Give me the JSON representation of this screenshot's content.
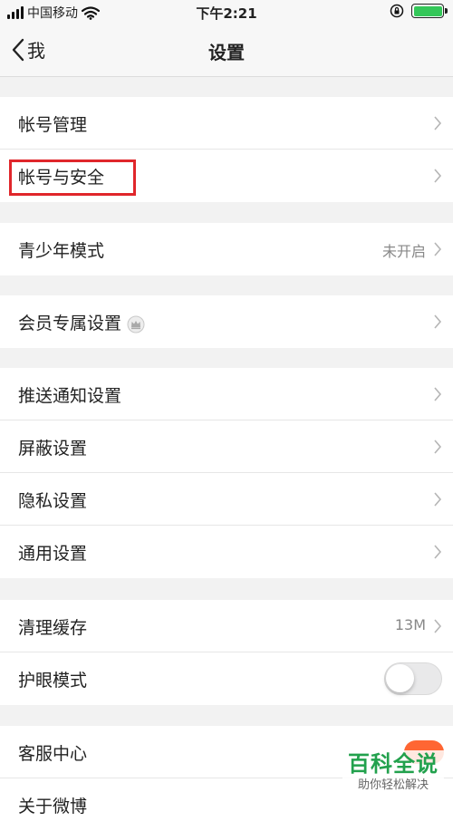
{
  "status_bar": {
    "carrier": "中国移动",
    "time": "下午2:21",
    "icons": [
      "signal-bars-icon",
      "wifi-icon",
      "orientation-lock-icon",
      "battery-icon"
    ],
    "battery_color": "#34c759"
  },
  "nav": {
    "back_label": "我",
    "title": "设置"
  },
  "groups": [
    {
      "items": [
        {
          "label": "帐号管理"
        },
        {
          "label": "帐号与安全"
        }
      ]
    },
    {
      "items": [
        {
          "label": "青少年模式",
          "value": "未开启"
        }
      ]
    },
    {
      "items": [
        {
          "label": "会员专属设置",
          "icon": "vip-crown-icon"
        }
      ]
    },
    {
      "items": [
        {
          "label": "推送通知设置"
        },
        {
          "label": "屏蔽设置"
        },
        {
          "label": "隐私设置"
        },
        {
          "label": "通用设置"
        }
      ]
    },
    {
      "items": [
        {
          "label": "清理缓存",
          "value": "13M"
        },
        {
          "label": "护眼模式",
          "toggle": false
        }
      ]
    },
    {
      "items": [
        {
          "label": "客服中心"
        },
        {
          "label": "关于微博"
        }
      ]
    }
  ],
  "annotation": {
    "highlight_color": "#e0262b"
  },
  "watermark": {
    "title": "百科全说",
    "subtitle": "助你轻松解决",
    "color": "#22a14d"
  }
}
